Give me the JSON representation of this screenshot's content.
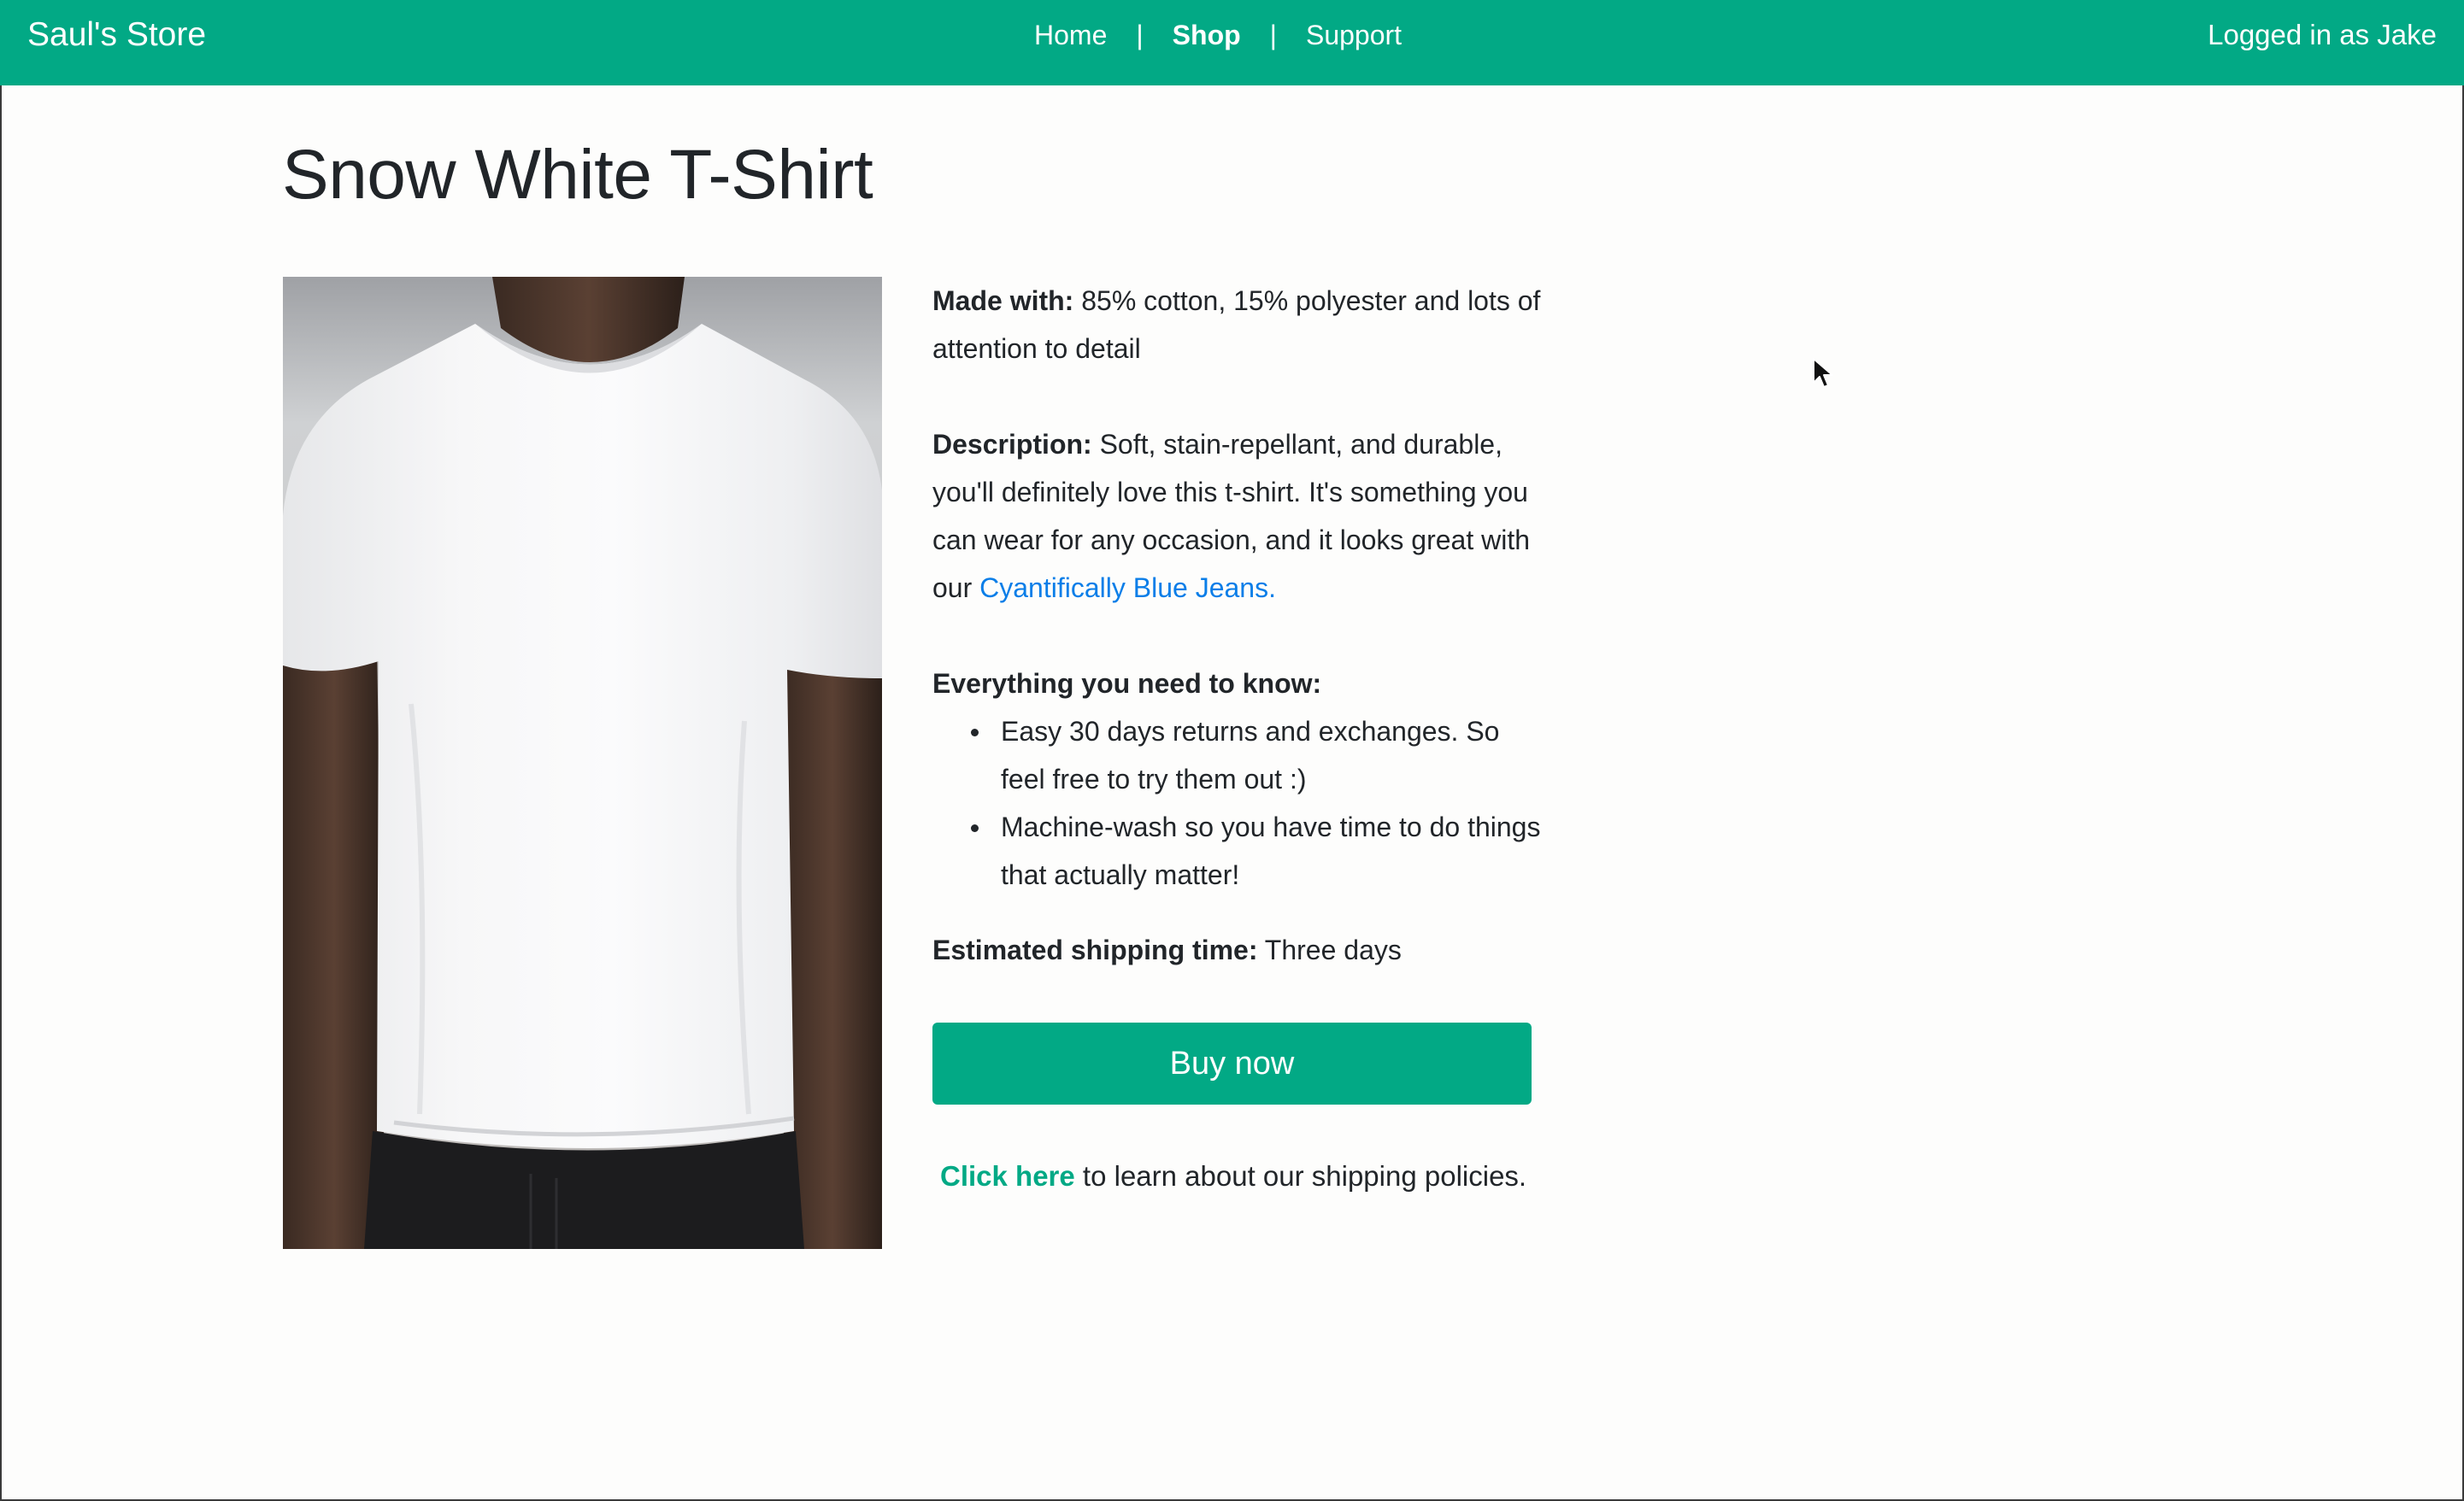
{
  "navbar": {
    "brand": "Saul's Store",
    "links": [
      {
        "label": "Home",
        "active": false
      },
      {
        "label": "Shop",
        "active": true
      },
      {
        "label": "Support",
        "active": false
      }
    ],
    "separator": "|",
    "user_status": "Logged in as Jake",
    "color": "#02a985"
  },
  "product": {
    "title": "Snow White T-Shirt",
    "image_subject": "white t-shirt worn by model",
    "made_with_label": "Made with:",
    "made_with_value": "85% cotton, 15% polyester and lots of attention to detail",
    "description_label": "Description:",
    "description_text": "Soft, stain-repellant, and durable, you'll definitely love this t-shirt. It's something you can wear for any occasion, and it looks great with our",
    "description_link": "Cyantifically Blue Jeans.",
    "need_to_know_label": "Everything you need to know:",
    "need_to_know_items": [
      "Easy 30 days returns and exchanges. So feel free to try them out :)",
      "Machine-wash so you have time to do things that actually matter!"
    ],
    "shipping_label": "Estimated shipping time:",
    "shipping_value": "Three days",
    "buy_label": "Buy now",
    "policy_link": "Click here",
    "policy_text": "to learn about our shipping policies."
  },
  "colors": {
    "accent": "#02a985",
    "link": "#0a7ee8",
    "text": "#212529"
  },
  "icons": {
    "cursor": "mouse-pointer-icon"
  }
}
